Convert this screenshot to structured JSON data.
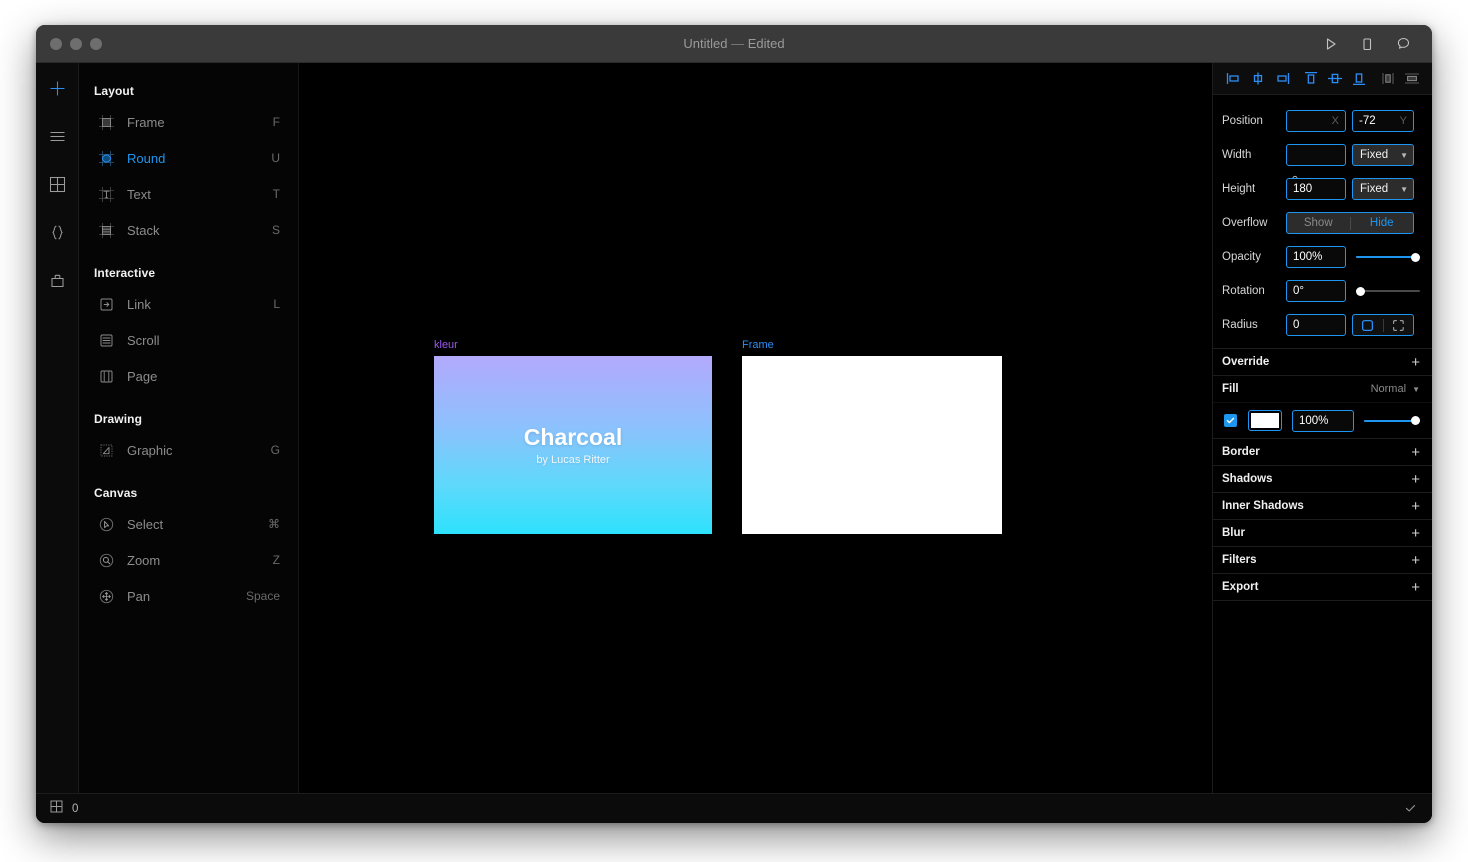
{
  "window": {
    "title": "Untitled",
    "title_dash": "—",
    "title_state": "Edited",
    "traffic_lights": [
      "close-button",
      "minimize-button",
      "maximize-button"
    ],
    "actions": [
      {
        "name": "preview-play-button",
        "icon": "play-icon"
      },
      {
        "name": "device-preview-button",
        "icon": "phone-icon"
      },
      {
        "name": "comments-button",
        "icon": "speech-bubble-icon"
      }
    ]
  },
  "rail": {
    "items": [
      {
        "name": "insert-button",
        "icon": "plus-icon",
        "accent": true
      },
      {
        "name": "layers-button",
        "icon": "hamburger-icon",
        "accent": false
      },
      {
        "name": "components-button",
        "icon": "grid-icon",
        "accent": false
      },
      {
        "name": "code-button",
        "icon": "braces-icon",
        "accent": false
      },
      {
        "name": "assets-button",
        "icon": "bag-icon",
        "accent": false
      }
    ]
  },
  "sidebar": {
    "groups": [
      {
        "title": "Layout",
        "items": [
          {
            "label": "Frame",
            "key": "F",
            "icon": "frame-icon",
            "selected": false
          },
          {
            "label": "Round",
            "key": "U",
            "icon": "ellipse-icon",
            "selected": true
          },
          {
            "label": "Text",
            "key": "T",
            "icon": "text-icon",
            "selected": false
          },
          {
            "label": "Stack",
            "key": "S",
            "icon": "stack-icon",
            "selected": false
          }
        ]
      },
      {
        "title": "Interactive",
        "items": [
          {
            "label": "Link",
            "key": "L",
            "icon": "link-icon",
            "selected": false
          },
          {
            "label": "Scroll",
            "key": "",
            "icon": "scroll-icon",
            "selected": false
          },
          {
            "label": "Page",
            "key": "",
            "icon": "page-icon",
            "selected": false
          }
        ]
      },
      {
        "title": "Drawing",
        "items": [
          {
            "label": "Graphic",
            "key": "G",
            "icon": "graphic-icon",
            "selected": false
          }
        ]
      },
      {
        "title": "Canvas",
        "items": [
          {
            "label": "Select",
            "key": "⌘",
            "icon": "cursor-icon",
            "selected": false
          },
          {
            "label": "Zoom",
            "key": "Z",
            "icon": "magnifier-icon",
            "selected": false
          },
          {
            "label": "Pan",
            "key": "Space",
            "icon": "move-icon",
            "selected": false
          }
        ]
      }
    ]
  },
  "canvas": {
    "artboards": [
      {
        "name": "kleur",
        "label_color": "#9b59f0",
        "kind": "gradient",
        "title": "Charcoal",
        "subtitle": "by Lucas Ritter",
        "gradient_from": "#b3a9fd",
        "gradient_to": "#2ee2fd"
      },
      {
        "name": "Frame",
        "label_color": "#2b8ef5",
        "kind": "blank",
        "fill": "#ffffff"
      }
    ]
  },
  "inspector": {
    "align_tools": [
      {
        "name": "align-left-button",
        "icon": "align-left-icon",
        "active": true
      },
      {
        "name": "align-horizontal-center-button",
        "icon": "align-h-center-icon",
        "active": true
      },
      {
        "name": "align-right-button",
        "icon": "align-right-icon",
        "active": true
      },
      {
        "name": "align-top-button",
        "icon": "align-top-icon",
        "active": true
      },
      {
        "name": "align-vertical-center-button",
        "icon": "align-v-center-icon",
        "active": true
      },
      {
        "name": "align-bottom-button",
        "icon": "align-bottom-icon",
        "active": true
      },
      {
        "name": "distribute-horizontal-button",
        "icon": "distribute-h-icon",
        "active": false
      },
      {
        "name": "distribute-vertical-button",
        "icon": "distribute-v-icon",
        "active": false
      }
    ],
    "position": {
      "label": "Position",
      "x_value": "",
      "x_unit": "X",
      "y_value": "-72",
      "y_unit": "Y"
    },
    "width": {
      "label": "Width",
      "value": "",
      "mode": "Fixed"
    },
    "height": {
      "label": "Height",
      "value": "180",
      "mode": "Fixed"
    },
    "overflow": {
      "label": "Overflow",
      "option_off": "Show",
      "option_on": "Hide"
    },
    "opacity": {
      "label": "Opacity",
      "value": "100%",
      "slider_percent": 100
    },
    "rotation": {
      "label": "Rotation",
      "value": "0°",
      "slider_percent": 0
    },
    "radius": {
      "label": "Radius",
      "value": "0",
      "mode_uniform_icon": "rounded-square-icon",
      "mode_individual_icon": "corners-icon"
    },
    "sections": [
      {
        "name": "Override",
        "action": "+"
      },
      {
        "name": "Border",
        "action": "+"
      },
      {
        "name": "Shadows",
        "action": "+"
      },
      {
        "name": "Inner Shadows",
        "action": "+"
      },
      {
        "name": "Blur",
        "action": "+"
      },
      {
        "name": "Filters",
        "action": "+"
      },
      {
        "name": "Export",
        "action": "+"
      }
    ],
    "fill": {
      "title": "Fill",
      "blend_mode": "Normal",
      "enabled": true,
      "color": "#ffffff",
      "opacity": "100%",
      "slider_percent": 100
    }
  },
  "statusbar": {
    "grid_icon": "grid-icon",
    "count": "0",
    "confirm_icon": "check-icon"
  },
  "colors": {
    "accent": "#1e96f0",
    "panel_bg": "#000000",
    "titlebar_bg": "#3a3a3a"
  }
}
